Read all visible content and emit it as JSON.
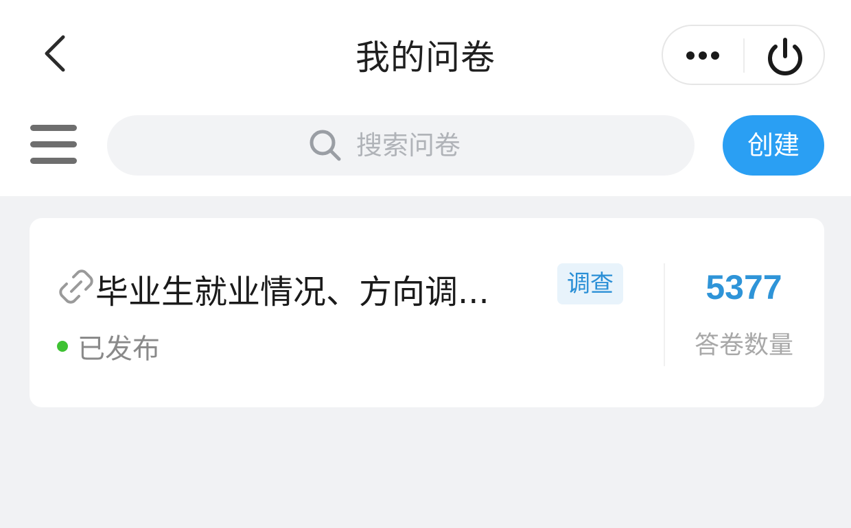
{
  "header": {
    "back_icon": "chevron-left-icon",
    "title": "我的问卷",
    "capsule": {
      "more_icon": "more-dots-icon",
      "power_icon": "power-icon"
    }
  },
  "toolbar": {
    "menu_icon": "hamburger-menu-icon",
    "search": {
      "icon": "search-icon",
      "placeholder": "搜索问卷",
      "value": ""
    },
    "create_label": "创建",
    "accent_color": "#2a9ff3"
  },
  "surveys": [
    {
      "icon": "link-icon",
      "title": "毕业生就业情况、方向调...",
      "type_badge": "调查",
      "status": "已发布",
      "status_color": "#3ec233",
      "count": "5377",
      "count_label": "答卷数量"
    }
  ]
}
